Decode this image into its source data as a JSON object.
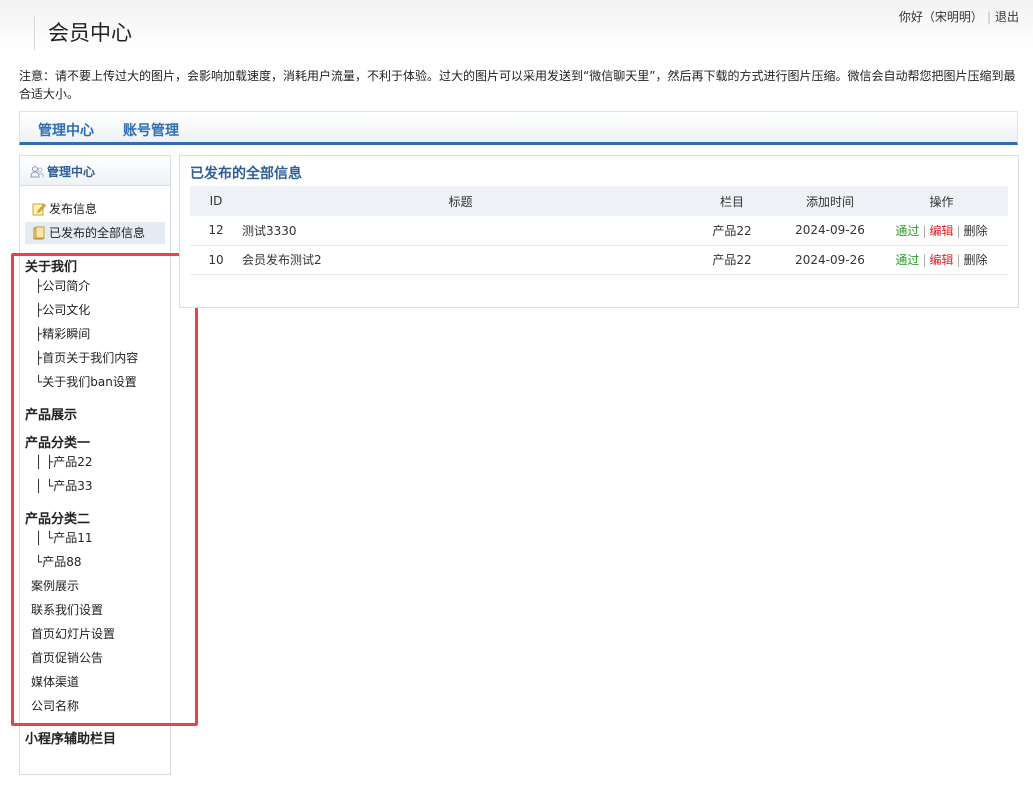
{
  "header": {
    "title": "会员中心",
    "greeting": "你好（宋明明）",
    "logout": "退出"
  },
  "notice": "注意：请不要上传过大的图片，会影响加载速度，消耗用户流量，不利于体验。过大的图片可以采用发送到“微信聊天里”，然后再下载的方式进行图片压缩。微信会自动帮您把图片压缩到最合适大小。",
  "nav": {
    "items": [
      "管理中心",
      "账号管理"
    ]
  },
  "sidebar": {
    "title": "管理中心",
    "actions": [
      "发布信息",
      "已发布的全部信息"
    ],
    "categories": [
      "关于我们",
      "├公司简介",
      "├公司文化",
      "├精彩瞬间",
      "├首页关于我们内容",
      "└关于我们ban设置",
      "产品展示",
      "产品分类一",
      "│ ├产品22",
      "│ └产品33",
      "产品分类二",
      "│ └产品11",
      "└产品88",
      "案例展示",
      "联系我们设置",
      "首页幻灯片设置",
      "首页促销公告",
      "媒体渠道",
      "公司名称",
      "小程序辅助栏目"
    ]
  },
  "main": {
    "title": "已发布的全部信息",
    "columns": [
      "ID",
      "标题",
      "栏目",
      "添加时间",
      "操作"
    ],
    "rows": [
      {
        "id": "12",
        "title": "测试3330",
        "column": "产品22",
        "time": "2024-09-26"
      },
      {
        "id": "10",
        "title": "会员发布测试2",
        "column": "产品22",
        "time": "2024-09-26"
      }
    ],
    "ops": {
      "pass": "通过",
      "edit": "编辑",
      "delete": "删除"
    }
  },
  "colors": {
    "accent": "#2f6eb5",
    "highlight_box": "#e8434b",
    "pass": "#2a9d2a",
    "edit": "#e02020"
  }
}
